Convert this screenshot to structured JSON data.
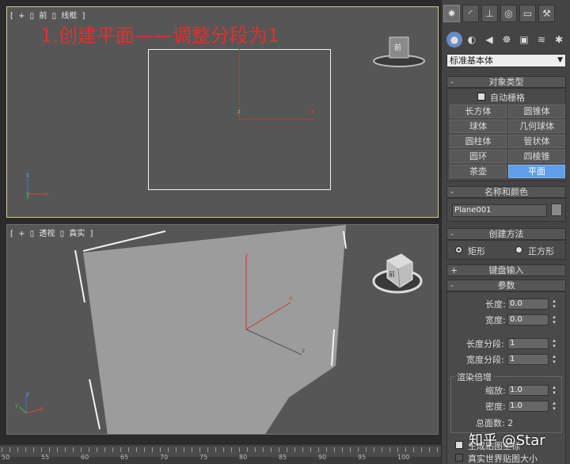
{
  "viewports": {
    "front": {
      "label_bracket_open": "[",
      "label_plus": "+",
      "label_sep1": "▯",
      "label_view": "前",
      "label_sep2": "▯",
      "label_shading": "线框",
      "label_bracket_close": "]",
      "annotation": "1.创建平面——调整分段为1",
      "cube_label": "前"
    },
    "perspective": {
      "label_bracket_open": "[",
      "label_plus": "+",
      "label_sep1": "▯",
      "label_view": "透视",
      "label_sep2": "▯",
      "label_shading": "真实",
      "label_bracket_close": "]",
      "cube_label": "前"
    },
    "axis_labels": {
      "x": "x",
      "y": "y",
      "z": "z"
    }
  },
  "timeline": {
    "ticks": [
      "50",
      "55",
      "60",
      "65",
      "70",
      "75",
      "80",
      "85",
      "90",
      "95",
      "100"
    ]
  },
  "panel": {
    "tabs": [
      "✸",
      "◜",
      "⊥",
      "◎",
      "▭",
      "⚒"
    ],
    "subtabs": [
      "●",
      "◐",
      "◀",
      "☸",
      "▣",
      "≋",
      "✱"
    ],
    "dropdown_value": "标准基本体",
    "object_type": {
      "title": "对象类型",
      "autogrid": "自动栅格",
      "buttons": [
        "长方体",
        "圆锥体",
        "球体",
        "几何球体",
        "圆柱体",
        "管状体",
        "圆环",
        "四棱锥",
        "茶壶",
        "平面"
      ],
      "active": "平面"
    },
    "name_color": {
      "title": "名称和颜色",
      "name": "Plane001"
    },
    "creation_method": {
      "title": "创建方法",
      "option_rect": "矩形",
      "option_square": "正方形"
    },
    "keyboard_entry": {
      "title": "键盘输入"
    },
    "parameters": {
      "title": "参数",
      "length_label": "长度:",
      "length_value": "0.0",
      "width_label": "宽度:",
      "width_value": "0.0",
      "length_segs_label": "长度分段:",
      "length_segs_value": "1",
      "width_segs_label": "宽度分段:",
      "width_segs_value": "1",
      "render_mult_title": "渲染倍增",
      "scale_label": "缩放:",
      "scale_value": "1.0",
      "density_label": "密度:",
      "density_value": "1.0",
      "total_faces": "总面数: 2",
      "gen_mapping": "生成贴图坐标",
      "real_world": "真实世界贴图大小"
    }
  },
  "watermark": "知乎 @Star",
  "colors": {
    "accent": "#5f9ee8",
    "annotation": "#e03030",
    "viewport_bg": "#565656"
  }
}
